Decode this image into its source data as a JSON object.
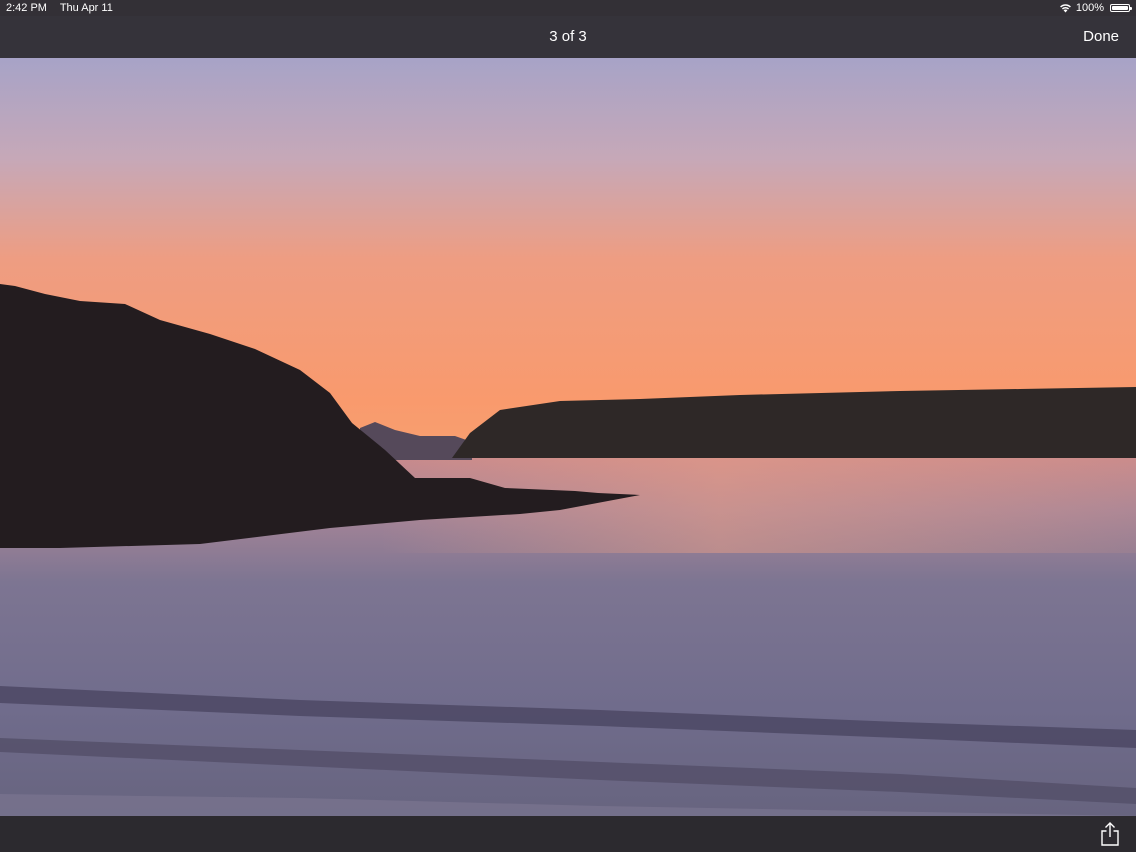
{
  "status_bar": {
    "time": "2:42 PM",
    "date": "Thu Apr 11",
    "battery": "100%",
    "icons": [
      "wifi-icon",
      "battery-icon"
    ]
  },
  "nav": {
    "title": "3 of 3",
    "done_label": "Done"
  },
  "photo": {
    "description_icon": "photo-image"
  },
  "toolbar": {
    "share_icon": "share-icon"
  },
  "colors": {
    "bar_background": "#35333a",
    "text": "#ffffff"
  }
}
